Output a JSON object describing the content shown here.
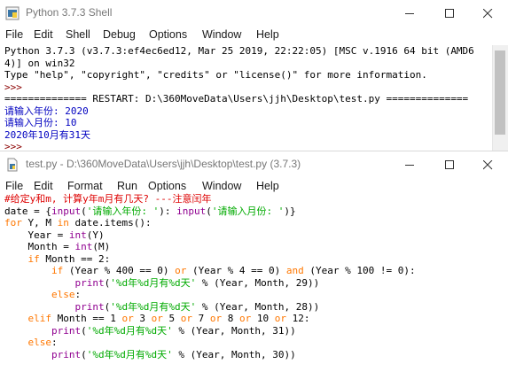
{
  "shell": {
    "title": "Python 3.7.3 Shell",
    "menu": [
      "File",
      "Edit",
      "Shell",
      "Debug",
      "Options",
      "Window",
      "Help"
    ],
    "lines": [
      [
        [
          "c-out",
          "Python 3.7.3 (v3.7.3:ef4ec6ed12, Mar 25 2019, 22:22:05) [MSC v.1916 64 bit (AMD6"
        ]
      ],
      [
        [
          "c-out",
          "4)] on win32"
        ]
      ],
      [
        [
          "c-out",
          "Type \"help\", \"copyright\", \"credits\" or \"license()\" for more information."
        ]
      ],
      [
        [
          "c-prompt",
          ">>> "
        ]
      ],
      [
        [
          "c-restart",
          "============== RESTART: D:\\360MoveData\\Users\\jjh\\Desktop\\test.py =============="
        ]
      ],
      [
        [
          "c-stdout",
          "请输入年份: 2020"
        ]
      ],
      [
        [
          "c-stdout",
          "请输入月份: 10"
        ]
      ],
      [
        [
          "c-stdout",
          "2020年10月有31天"
        ]
      ],
      [
        [
          "c-prompt",
          ">>> "
        ]
      ]
    ]
  },
  "editor": {
    "title": "test.py - D:\\360MoveData\\Users\\jjh\\Desktop\\test.py (3.7.3)",
    "menu": [
      "File",
      "Edit",
      "Format",
      "Run",
      "Options",
      "Window",
      "Help"
    ],
    "lines": [
      [
        [
          "c-comment",
          "#给定y和m, 计算y年m月有几天? ---注意闰年"
        ]
      ],
      [
        [
          "c-def",
          "date = {"
        ],
        [
          "c-builtin",
          "input"
        ],
        [
          "c-def",
          "("
        ],
        [
          "c-str",
          "'请输入年份: '"
        ],
        [
          "c-def",
          "): "
        ],
        [
          "c-builtin",
          "input"
        ],
        [
          "c-def",
          "("
        ],
        [
          "c-str",
          "'请输入月份: '"
        ],
        [
          "c-def",
          ")}"
        ]
      ],
      [
        [
          "c-kw",
          "for"
        ],
        [
          "c-def",
          " Y, M "
        ],
        [
          "c-kw",
          "in"
        ],
        [
          "c-def",
          " date.items():"
        ]
      ],
      [
        [
          "c-def",
          "    Year = "
        ],
        [
          "c-builtin",
          "int"
        ],
        [
          "c-def",
          "(Y)"
        ]
      ],
      [
        [
          "c-def",
          "    Month = "
        ],
        [
          "c-builtin",
          "int"
        ],
        [
          "c-def",
          "(M)"
        ]
      ],
      [
        [
          "c-def",
          "    "
        ],
        [
          "c-kw",
          "if"
        ],
        [
          "c-def",
          " Month == 2:"
        ]
      ],
      [
        [
          "c-def",
          "        "
        ],
        [
          "c-kw",
          "if"
        ],
        [
          "c-def",
          " (Year % 400 == 0) "
        ],
        [
          "c-kw",
          "or"
        ],
        [
          "c-def",
          " (Year % 4 == 0) "
        ],
        [
          "c-kw",
          "and"
        ],
        [
          "c-def",
          " (Year % 100 != 0):"
        ]
      ],
      [
        [
          "c-def",
          "            "
        ],
        [
          "c-builtin",
          "print"
        ],
        [
          "c-def",
          "("
        ],
        [
          "c-str",
          "'%d年%d月有%d天'"
        ],
        [
          "c-def",
          " % (Year, Month, 29))"
        ]
      ],
      [
        [
          "c-def",
          "        "
        ],
        [
          "c-kw",
          "else"
        ],
        [
          "c-def",
          ":"
        ]
      ],
      [
        [
          "c-def",
          "            "
        ],
        [
          "c-builtin",
          "print"
        ],
        [
          "c-def",
          "("
        ],
        [
          "c-str",
          "'%d年%d月有%d天'"
        ],
        [
          "c-def",
          " % (Year, Month, 28))"
        ]
      ],
      [
        [
          "c-def",
          "    "
        ],
        [
          "c-kw",
          "elif"
        ],
        [
          "c-def",
          " Month == 1 "
        ],
        [
          "c-kw",
          "or"
        ],
        [
          "c-def",
          " 3 "
        ],
        [
          "c-kw",
          "or"
        ],
        [
          "c-def",
          " 5 "
        ],
        [
          "c-kw",
          "or"
        ],
        [
          "c-def",
          " 7 "
        ],
        [
          "c-kw",
          "or"
        ],
        [
          "c-def",
          " 8 "
        ],
        [
          "c-kw",
          "or"
        ],
        [
          "c-def",
          " 10 "
        ],
        [
          "c-kw",
          "or"
        ],
        [
          "c-def",
          " 12:"
        ]
      ],
      [
        [
          "c-def",
          "        "
        ],
        [
          "c-builtin",
          "print"
        ],
        [
          "c-def",
          "("
        ],
        [
          "c-str",
          "'%d年%d月有%d天'"
        ],
        [
          "c-def",
          " % (Year, Month, 31))"
        ]
      ],
      [
        [
          "c-def",
          "    "
        ],
        [
          "c-kw",
          "else"
        ],
        [
          "c-def",
          ":"
        ]
      ],
      [
        [
          "c-def",
          "        "
        ],
        [
          "c-builtin",
          "print"
        ],
        [
          "c-def",
          "("
        ],
        [
          "c-str",
          "'%d年%d月有%d天'"
        ],
        [
          "c-def",
          " % (Year, Month, 30))"
        ]
      ]
    ]
  },
  "icons": {
    "app": "python-idle-icon",
    "minimize": "minimize-icon",
    "maximize": "maximize-icon",
    "close": "close-icon"
  },
  "colors": {
    "keyword": "#ff7700",
    "builtin": "#900090",
    "string": "#00aa00",
    "comment": "#dd0000",
    "stdout": "#0000c0",
    "prompt": "#8b0000"
  }
}
